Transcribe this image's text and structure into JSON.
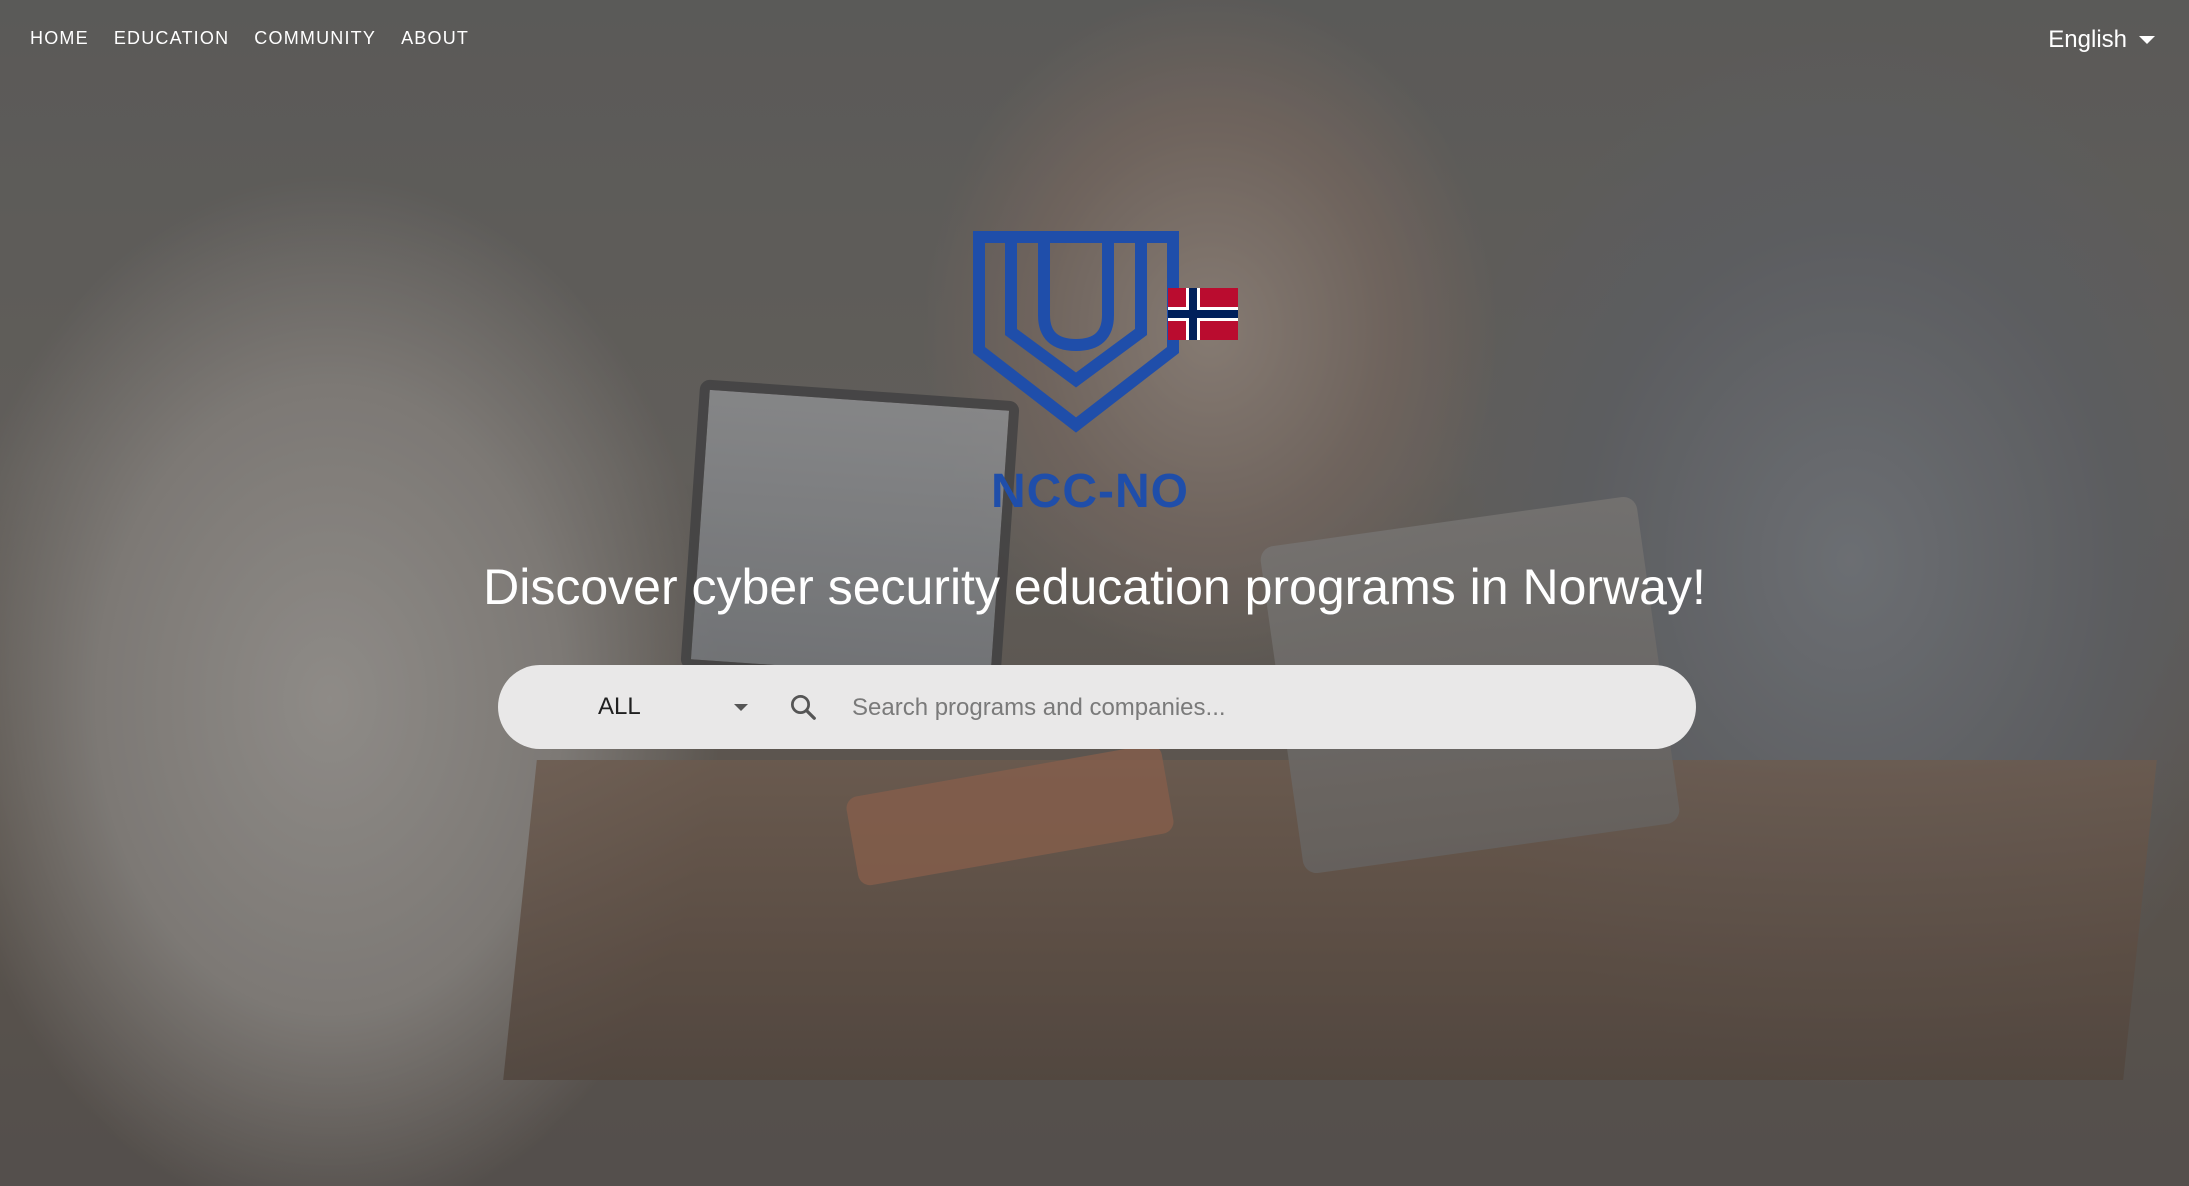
{
  "nav": {
    "items": [
      {
        "label": "HOME"
      },
      {
        "label": "EDUCATION"
      },
      {
        "label": "COMMUNITY"
      },
      {
        "label": "ABOUT"
      }
    ]
  },
  "language": {
    "selected": "English",
    "icon": "chevron-down-icon"
  },
  "logo": {
    "text": "NCC-NO",
    "brand_color": "#1f4eaa",
    "flag_icon": "norway-flag-icon"
  },
  "hero": {
    "headline": "Discover cyber security education programs in Norway!"
  },
  "search": {
    "category_selected": "ALL",
    "value": "",
    "placeholder": "Search programs and companies...",
    "icon": "search-icon"
  }
}
